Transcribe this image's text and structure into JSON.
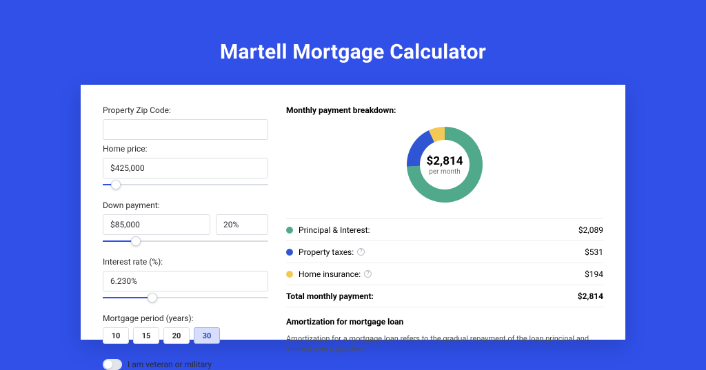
{
  "hero": "Martell Mortgage Calculator",
  "form": {
    "zip": {
      "label": "Property Zip Code:",
      "value": ""
    },
    "price": {
      "label": "Home price:",
      "value": "$425,000",
      "slider_pct": 8
    },
    "down": {
      "label": "Down payment:",
      "value": "$85,000",
      "pct": "20%",
      "slider_pct": 20
    },
    "rate": {
      "label": "Interest rate (%):",
      "value": "6.230%",
      "slider_pct": 30
    },
    "period": {
      "label": "Mortgage period (years):",
      "options": [
        "10",
        "15",
        "20",
        "30"
      ],
      "selected": "30"
    },
    "veteran": {
      "label": "I am veteran or military",
      "on": false
    }
  },
  "breakdown": {
    "title": "Monthly payment breakdown:",
    "amount": "$2,814",
    "sub": "per month",
    "rows": [
      {
        "key": "pi",
        "name": "Principal & Interest:",
        "value": "$2,089"
      },
      {
        "key": "tax",
        "name": "Property taxes:",
        "value": "$531",
        "info": true
      },
      {
        "key": "ins",
        "name": "Home insurance:",
        "value": "$194",
        "info": true
      }
    ],
    "total": {
      "name": "Total monthly payment:",
      "value": "$2,814"
    }
  },
  "chart_data": {
    "type": "pie",
    "title": "Monthly payment breakdown",
    "total_label": "$2,814 per month",
    "series": [
      {
        "name": "Principal & Interest",
        "value": 2089,
        "color": "#4fa98a"
      },
      {
        "name": "Property taxes",
        "value": 531,
        "color": "#2f55d4"
      },
      {
        "name": "Home insurance",
        "value": 194,
        "color": "#f2c955"
      }
    ]
  },
  "amort": {
    "title": "Amortization for mortgage loan",
    "body": "Amortization for a mortgage loan refers to the gradual repayment of the loan principal and interest over a specified"
  }
}
